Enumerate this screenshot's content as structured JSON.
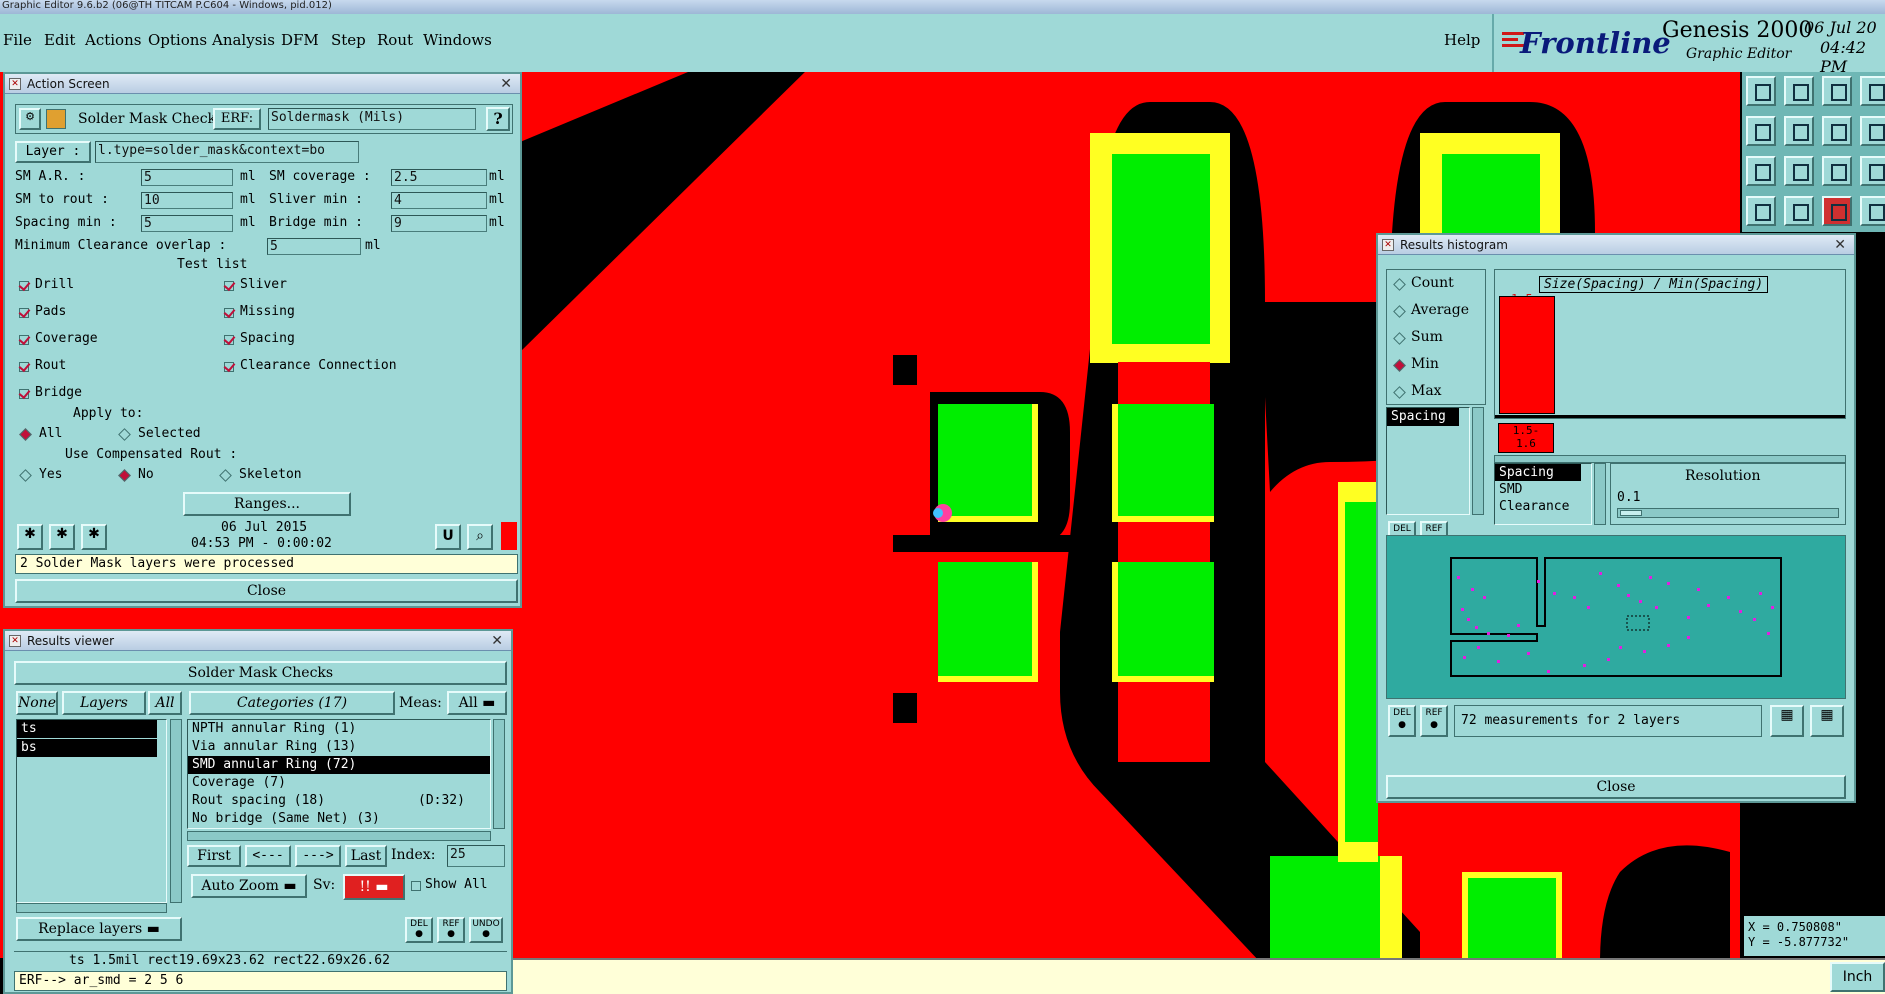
{
  "window_title": "Graphic Editor 9.6.b2 (06@TH TITCAM P.C604 - Windows, pid.012)",
  "menu": [
    "File",
    "Edit",
    "Actions",
    "Options",
    "Analysis",
    "DFM",
    "Step",
    "Rout",
    "Windows"
  ],
  "help": "Help",
  "brand": {
    "logo": "Frontline",
    "product": "Genesis 2000",
    "subtitle": "Graphic Editor",
    "date": "06 Jul 20",
    "time": "04:42 PM"
  },
  "colors": {
    "canvas": "#ff0000",
    "pad": "#00ee00",
    "mask": "#ffff22",
    "panel": "#9fd9d7",
    "selected_radio": "#c0103a"
  },
  "action_screen": {
    "title": "Action Screen",
    "action_name": "Solder Mask Checks",
    "erf_label": "ERF:",
    "erf_value": "Soldermask (Mils)",
    "help_btn": "?",
    "layer_label": "Layer :",
    "layer_value": "l.type=solder_mask&context=bo",
    "params": [
      {
        "label": "SM A.R.       :",
        "value": "5",
        "unit": "ml"
      },
      {
        "label": "SM coverage :",
        "value": "2.5",
        "unit": "ml"
      },
      {
        "label": "SM to rout    :",
        "value": "10",
        "unit": "ml"
      },
      {
        "label": "Sliver  min :",
        "value": "4",
        "unit": "ml"
      },
      {
        "label": "Spacing min :",
        "value": "5",
        "unit": "ml"
      },
      {
        "label": "Bridge  min :",
        "value": "9",
        "unit": "ml"
      }
    ],
    "min_clear_label": "Minimum Clearance overlap :",
    "min_clear_value": "5",
    "min_clear_unit": "ml",
    "test_list_label": "Test list",
    "tests_left": [
      "Drill",
      "Pads",
      "Coverage",
      "Rout",
      "Bridge"
    ],
    "tests_right": [
      "Sliver",
      "Missing",
      "Spacing",
      "Clearance Connection"
    ],
    "apply_to_label": "Apply to:",
    "apply_all": "All",
    "apply_selected": "Selected",
    "use_comp_label": "Use Compensated Rout :",
    "comp_yes": "Yes",
    "comp_no": "No",
    "comp_skeleton": "Skeleton",
    "ranges_btn": "Ranges...",
    "run_date": "06 Jul 2015",
    "run_time": "04:53 PM - 0:00:02",
    "u_btn": "U",
    "message": "2 Solder Mask layers were processed",
    "close_btn": "Close"
  },
  "results_viewer": {
    "title": "Results viewer",
    "header": "Solder Mask Checks",
    "none_btn": "None",
    "layers_btn": "Layers",
    "all_btn": "All",
    "categories_btn": "Categories (17)",
    "meas_label": "Meas:",
    "meas_value": "All",
    "layers": [
      "ts",
      "bs"
    ],
    "categories": [
      {
        "name": "NPTH annular Ring (1)",
        "extra": ""
      },
      {
        "name": "Via annular Ring (13)",
        "extra": ""
      },
      {
        "name": "SMD annular Ring (72)",
        "extra": ""
      },
      {
        "name": "Coverage (7)",
        "extra": ""
      },
      {
        "name": "Rout spacing (18)",
        "extra": "(D:32)"
      },
      {
        "name": "No bridge (Same Net) (3)",
        "extra": ""
      }
    ],
    "selected_category": 2,
    "first_btn": "First",
    "prev_btn": "<---",
    "next_btn": "--->",
    "last_btn": "Last",
    "index_label": "Index:",
    "index_value": "25",
    "autozoom_btn": "Auto Zoom",
    "sv_label": "Sv:",
    "sv_value": "!!",
    "show_all_label": "Show All",
    "replace_btn": "Replace layers",
    "del_label": "DEL",
    "ref_label": "REF",
    "undo_label": "UNDO",
    "info_line": "ts 1.5mil   rect19.69x23.62   rect22.69x26.62",
    "erf_line": "ERF--> ar_smd = 2 5 6"
  },
  "histogram": {
    "title": "Results histogram",
    "modes": [
      "Count",
      "Average",
      "Sum",
      "Min",
      "Max"
    ],
    "selected_mode": 3,
    "measures": [
      "Spacing"
    ],
    "chart_title": "Size(Spacing) / Min(Spacing)",
    "bar_value_label": "1.5",
    "bar_range_label": "1.5-\n1.6",
    "types": [
      "Spacing",
      "SMD",
      "Clearance"
    ],
    "resolution_label": "Resolution",
    "resolution_value": "0.1",
    "del_label": "DEL",
    "ref_label": "REF",
    "measurements_text": "72 measurements for 2 layers",
    "close_btn": "Close"
  },
  "chart_data": {
    "type": "bar",
    "title": "Size(Spacing) / Min(Spacing)",
    "categories": [
      "1.5-1.6"
    ],
    "values": [
      1.5
    ],
    "xlabel": "",
    "ylabel": ""
  },
  "coords": {
    "x": "X = 0.750808\"",
    "y": "Y = -5.877732\""
  },
  "units": "Inch"
}
